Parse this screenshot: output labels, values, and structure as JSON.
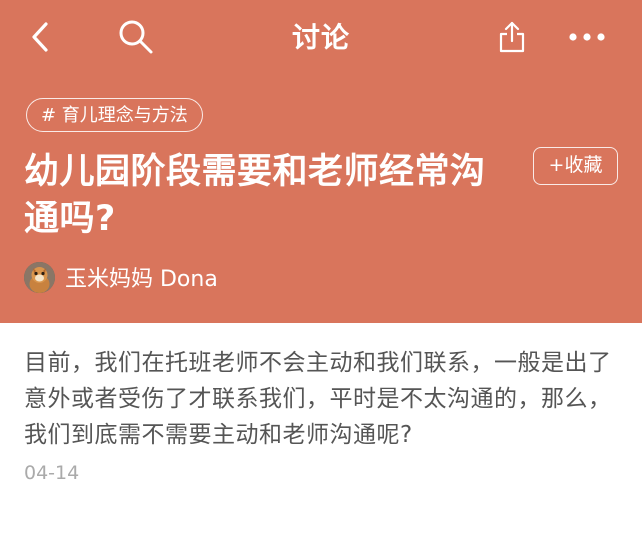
{
  "navbar": {
    "title": "讨论",
    "back_icon": "chevron-left-icon",
    "search_icon": "search-icon",
    "share_icon": "share-icon",
    "more_icon": "more-icon"
  },
  "post": {
    "tag": "# 育儿理念与方法",
    "title": "幼儿园阶段需要和老师经常沟通吗?",
    "favorite_label": "+收藏",
    "author": "玉米妈妈 Dona",
    "body": "目前，我们在托班老师不会主动和我们联系，一般是出了意外或者受伤了才联系我们，平时是不太沟通的，那么，我们到底需不需要主动和老师沟通呢?",
    "date": "04-14"
  },
  "colors": {
    "header_bg": "#d9755c",
    "header_text": "#ffffff",
    "body_text": "#555555",
    "date_text": "#aaaaaa"
  }
}
